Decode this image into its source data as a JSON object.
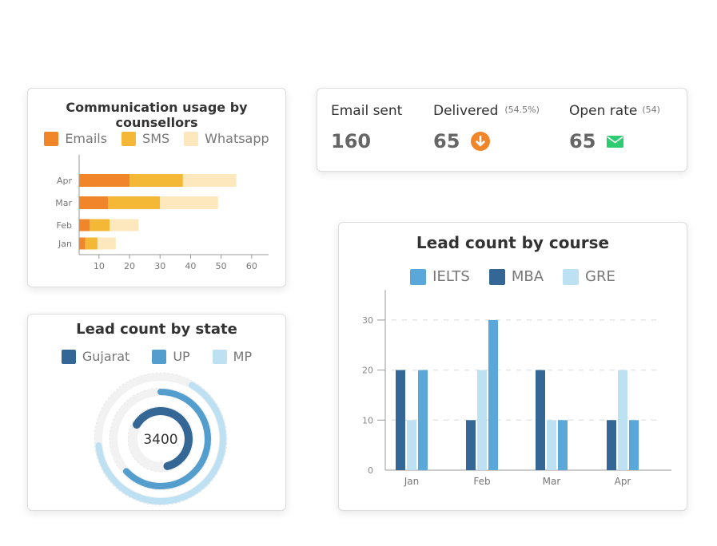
{
  "colors": {
    "emails": "#f0852a",
    "sms": "#f4b836",
    "whatsapp": "#fde8bd",
    "mba": "#346796",
    "ielts": "#5aa8da",
    "gre": "#bee0f3",
    "gujarat": "#346796",
    "up": "#549ece",
    "mp": "#bee0f3",
    "down": "#f0852a",
    "mail": "#2ecc71"
  },
  "kpis": [
    {
      "label": "Email sent",
      "sub": "",
      "value": "160",
      "icon": "none"
    },
    {
      "label": "Delivered",
      "sub": "(54.5%)",
      "value": "65",
      "icon": "arrow-down-circle-icon"
    },
    {
      "label": "Open rate",
      "sub": "(54)",
      "value": "65",
      "icon": "envelope-icon"
    }
  ],
  "chart_data": [
    {
      "type": "bar",
      "orientation": "horizontal",
      "stacked": true,
      "title": "Communication usage by counsellors",
      "categories": [
        "Jan",
        "Feb",
        "Mar",
        "Apr"
      ],
      "series": [
        {
          "name": "Emails",
          "values": [
            2,
            3.5,
            9.5,
            16.5
          ]
        },
        {
          "name": "SMS",
          "values": [
            4,
            6.5,
            17,
            17.5
          ]
        },
        {
          "name": "Whatsapp",
          "values": [
            6,
            9.5,
            19,
            17.5
          ]
        }
      ],
      "xticks": [
        10,
        20,
        30,
        40,
        50,
        60
      ],
      "xlim": [
        3.5,
        66
      ],
      "legend": "top"
    },
    {
      "type": "pie",
      "variant": "radial-rings",
      "title": "Lead count by state",
      "center_label": "3400",
      "series": [
        {
          "name": "Gujarat",
          "percent": 62.5
        },
        {
          "name": "UP",
          "percent": 63
        },
        {
          "name": "MP",
          "percent": 65
        }
      ],
      "legend": "top"
    },
    {
      "type": "bar",
      "orientation": "vertical",
      "title": "Lead count by course",
      "categories": [
        "Jan",
        "Feb",
        "Mar",
        "Apr"
      ],
      "legend_order": [
        "IELTS",
        "MBA",
        "GRE"
      ],
      "series": [
        {
          "name": "MBA",
          "values": [
            20,
            10,
            20,
            10
          ]
        },
        {
          "name": "GRE",
          "values": [
            10,
            20,
            10,
            20
          ]
        },
        {
          "name": "IELTS",
          "values": [
            20,
            30,
            10,
            10
          ]
        }
      ],
      "yticks": [
        0,
        10,
        20,
        30
      ],
      "ylim": [
        0,
        36
      ],
      "grid": true,
      "legend": "top"
    }
  ]
}
